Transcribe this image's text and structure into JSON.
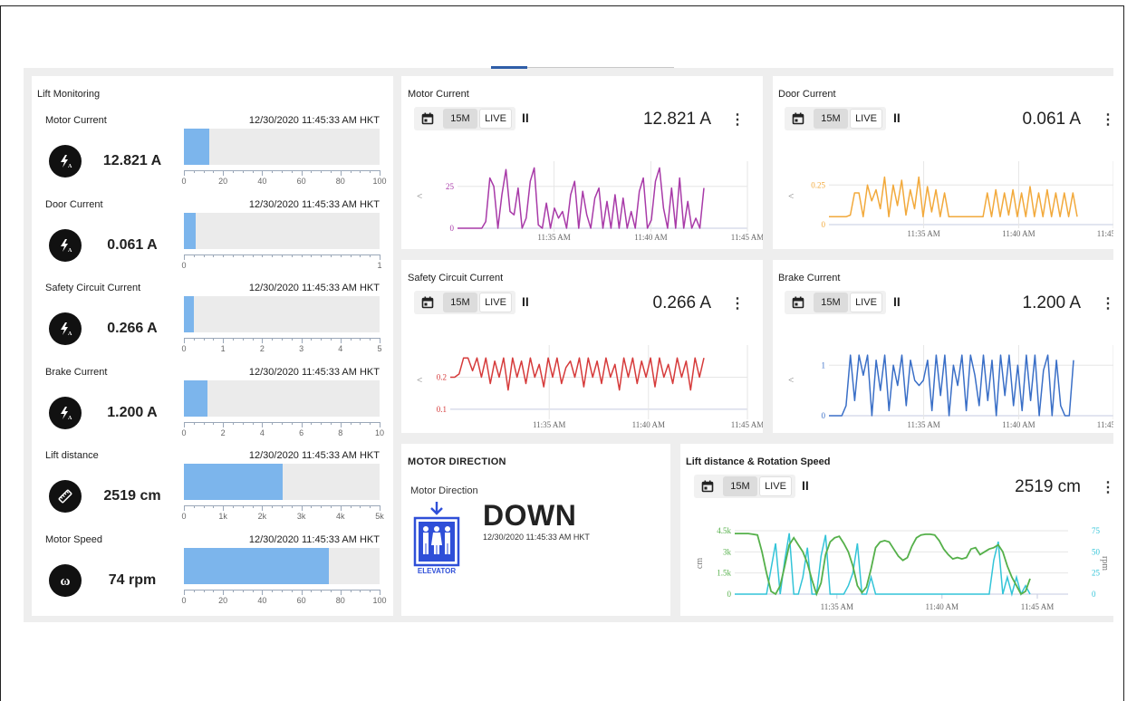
{
  "lift_monitoring": {
    "title": "Lift Monitoring",
    "gauges": [
      {
        "label": "Motor Current",
        "timestamp": "12/30/2020 11:45:33 AM HKT",
        "value": "12.821 A",
        "icon": "lightning-icon",
        "fraction": 0.128,
        "ticks": [
          "0",
          "20",
          "40",
          "60",
          "80",
          "100"
        ]
      },
      {
        "label": "Door Current",
        "timestamp": "12/30/2020 11:45:33 AM HKT",
        "value": "0.061 A",
        "icon": "lightning-icon",
        "fraction": 0.061,
        "ticks": [
          "0",
          "1"
        ]
      },
      {
        "label": "Safety Circuit Current",
        "timestamp": "12/30/2020 11:45:33 AM HKT",
        "value": "0.266 A",
        "icon": "lightning-icon",
        "fraction": 0.053,
        "ticks": [
          "0",
          "1",
          "2",
          "3",
          "4",
          "5"
        ]
      },
      {
        "label": "Brake Current",
        "timestamp": "12/30/2020 11:45:33 AM HKT",
        "value": "1.200 A",
        "icon": "lightning-icon",
        "fraction": 0.12,
        "ticks": [
          "0",
          "2",
          "4",
          "6",
          "8",
          "10"
        ]
      },
      {
        "label": "Lift distance",
        "timestamp": "12/30/2020 11:45:33 AM HKT",
        "value": "2519 cm",
        "icon": "ruler-icon",
        "fraction": 0.5038,
        "ticks": [
          "0",
          "1k",
          "2k",
          "3k",
          "4k",
          "5k"
        ]
      },
      {
        "label": "Motor Speed",
        "timestamp": "12/30/2020 11:45:33 AM HKT",
        "value": "74 rpm",
        "icon": "omega-icon",
        "fraction": 0.74,
        "ticks": [
          "0",
          "20",
          "40",
          "60",
          "80",
          "100"
        ]
      }
    ]
  },
  "toolbar": {
    "range_label": "15M",
    "live_label": "LIVE",
    "pause_symbol": "II",
    "menu_symbol": "⋮",
    "collapse_symbol": "<"
  },
  "cards": [
    {
      "id": "motor-current",
      "title": "Motor Current",
      "value": "12.821 A",
      "color": "#a83aa8"
    },
    {
      "id": "door-current",
      "title": "Door Current",
      "value": "0.061 A",
      "color": "#f2a93b"
    },
    {
      "id": "safety-circuit-current",
      "title": "Safety Circuit Current",
      "value": "0.266 A",
      "color": "#d63b3b"
    },
    {
      "id": "brake-current",
      "title": "Brake Current",
      "value": "1.200 A",
      "color": "#3a6fc7"
    },
    {
      "id": "lift-distance",
      "title": "Lift distance & Rotation Speed",
      "value": "2519 cm",
      "color": "#55b04a"
    }
  ],
  "motor_direction": {
    "title": "MOTOR DIRECTION",
    "subtitle": "Motor Direction",
    "value": "DOWN",
    "timestamp": "12/30/2020 11:45:33 AM HKT",
    "icon_text": "ELEVATOR",
    "icon": "elevator-down-icon",
    "icon_color": "#2f4fd8"
  },
  "chart_data": [
    {
      "type": "line",
      "title": "Motor Current",
      "x_ticks": [
        "11:35 AM",
        "11:40 AM",
        "11:45 AM"
      ],
      "y_ticks": [
        "0",
        "25"
      ],
      "ylim": [
        0,
        40
      ],
      "series": [
        {
          "values": [
            0,
            0,
            0,
            0,
            0,
            0,
            0,
            4,
            30,
            25,
            0,
            20,
            35,
            10,
            8,
            24,
            0,
            6,
            28,
            36,
            2,
            0,
            15,
            0,
            12,
            6,
            10,
            0,
            20,
            28,
            0,
            22,
            8,
            0,
            18,
            24,
            0,
            16,
            0,
            20,
            0,
            18,
            0,
            10,
            0,
            22,
            30,
            0,
            5,
            28,
            36,
            12,
            0,
            24,
            0,
            30,
            0,
            16,
            0,
            6,
            0,
            24
          ]
        }
      ]
    },
    {
      "type": "line",
      "title": "Door Current",
      "x_ticks": [
        "11:35 AM",
        "11:40 AM",
        "11:45 AM"
      ],
      "y_ticks": [
        "0",
        "0.25"
      ],
      "ylim": [
        0,
        0.4
      ],
      "series": [
        {
          "values": [
            0.05,
            0.05,
            0.05,
            0.05,
            0.05,
            0.06,
            0.2,
            0.2,
            0.05,
            0.25,
            0.15,
            0.22,
            0.1,
            0.3,
            0.05,
            0.25,
            0.12,
            0.28,
            0.06,
            0.22,
            0.1,
            0.3,
            0.05,
            0.24,
            0.08,
            0.22,
            0.05,
            0.2,
            0.05,
            0.05,
            0.05,
            0.05,
            0.05,
            0.05,
            0.05,
            0.05,
            0.05,
            0.2,
            0.05,
            0.22,
            0.05,
            0.2,
            0.06,
            0.22,
            0.05,
            0.2,
            0.05,
            0.24,
            0.05,
            0.2,
            0.05,
            0.22,
            0.05,
            0.2,
            0.05,
            0.2,
            0.05,
            0.2,
            0.05
          ]
        }
      ]
    },
    {
      "type": "line",
      "title": "Safety Circuit Current",
      "x_ticks": [
        "11:35 AM",
        "11:40 AM",
        "11:45 AM"
      ],
      "y_ticks": [
        "0.1",
        "0.2"
      ],
      "ylim": [
        0.08,
        0.3
      ],
      "series": [
        {
          "values": [
            0.2,
            0.2,
            0.21,
            0.26,
            0.26,
            0.22,
            0.26,
            0.2,
            0.26,
            0.18,
            0.25,
            0.2,
            0.26,
            0.16,
            0.26,
            0.2,
            0.25,
            0.18,
            0.26,
            0.2,
            0.24,
            0.17,
            0.26,
            0.2,
            0.26,
            0.18,
            0.23,
            0.25,
            0.2,
            0.26,
            0.17,
            0.26,
            0.2,
            0.25,
            0.18,
            0.26,
            0.2,
            0.24,
            0.16,
            0.26,
            0.2,
            0.26,
            0.18,
            0.25,
            0.2,
            0.26,
            0.17,
            0.26,
            0.2,
            0.24,
            0.18,
            0.26,
            0.2,
            0.25,
            0.16,
            0.26,
            0.2,
            0.26
          ]
        }
      ]
    },
    {
      "type": "line",
      "title": "Brake Current",
      "x_ticks": [
        "11:35 AM",
        "11:40 AM",
        "11:45 AM"
      ],
      "y_ticks": [
        "0",
        "1"
      ],
      "ylim": [
        0,
        1.4
      ],
      "series": [
        {
          "values": [
            0,
            0,
            0,
            0,
            0.2,
            1.2,
            0.3,
            1.2,
            0.8,
            1.2,
            0,
            1.1,
            0.5,
            1.2,
            0.1,
            1.0,
            0.6,
            1.2,
            0.2,
            1.1,
            0.7,
            0.6,
            0.7,
            1.1,
            0.1,
            1.2,
            0.4,
            1.2,
            0,
            1.0,
            0.6,
            1.2,
            0.1,
            1.2,
            0.8,
            0.2,
            1.2,
            0.3,
            1.1,
            0,
            1.2,
            0.4,
            1.2,
            0.2,
            1.0,
            0.1,
            1.2,
            0.3,
            1.2,
            0,
            0.9,
            1.2,
            0,
            1.1,
            0.2,
            0,
            0,
            1.1
          ]
        }
      ]
    },
    {
      "type": "line",
      "title": "Lift distance & Rotation Speed",
      "x_ticks": [
        "11:35 AM",
        "11:40 AM",
        "11:45 AM"
      ],
      "y_ticks": [
        "0",
        "1.5k",
        "3k",
        "4.5k"
      ],
      "y2_ticks": [
        "0",
        "25",
        "50",
        "75"
      ],
      "ylabel": "cm",
      "y2label": "rpm",
      "series": [
        {
          "name": "Lift distance",
          "axis": "left",
          "ylim": [
            0,
            4500
          ],
          "values": [
            4300,
            4300,
            4300,
            4300,
            4250,
            4200,
            3000,
            1500,
            200,
            0,
            600,
            2000,
            3500,
            4000,
            3500,
            3000,
            2200,
            1000,
            0,
            800,
            2800,
            3700,
            4000,
            4100,
            3600,
            3000,
            2000,
            600,
            100,
            500,
            1800,
            3300,
            3700,
            3800,
            3700,
            3200,
            2700,
            2400,
            2600,
            3400,
            4000,
            4200,
            4250,
            4250,
            4200,
            3800,
            3200,
            2800,
            2500,
            2600,
            2500,
            2600,
            3200,
            3300,
            2800,
            3000,
            3200,
            3300,
            3500,
            3000,
            2000,
            1200,
            600,
            0,
            200,
            1100
          ]
        },
        {
          "name": "Motor Speed",
          "axis": "right",
          "ylim": [
            0,
            85
          ],
          "values": [
            0,
            0,
            0,
            0,
            0,
            0,
            0,
            0,
            30,
            60,
            0,
            40,
            72,
            0,
            0,
            20,
            55,
            0,
            0,
            45,
            70,
            0,
            0,
            0,
            0,
            10,
            25,
            60,
            0,
            0,
            20,
            0,
            0,
            0,
            0,
            0,
            0,
            0,
            0,
            0,
            0,
            0,
            0,
            0,
            0,
            0,
            0,
            0,
            0,
            0,
            0,
            0,
            0,
            0,
            0,
            0,
            0,
            40,
            62,
            0,
            20,
            0,
            20,
            0,
            10,
            0
          ]
        }
      ]
    }
  ]
}
